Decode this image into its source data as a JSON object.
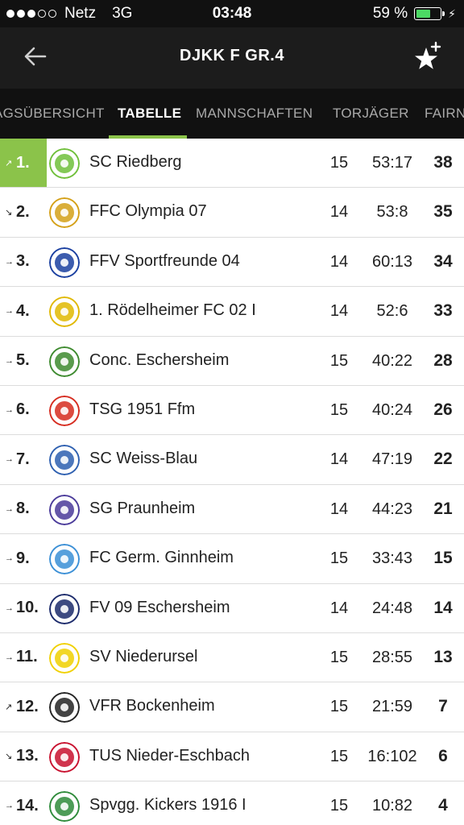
{
  "status_bar": {
    "carrier": "Netz",
    "network": "3G",
    "time": "03:48",
    "battery_percent": "59 %",
    "battery_level": 0.59
  },
  "navbar": {
    "title": "DJKK F GR.4",
    "back_icon": "back-arrow-icon",
    "favorite_icon": "star-plus-icon"
  },
  "tabs": [
    {
      "label": "AGSÜBERSICHT",
      "active": false
    },
    {
      "label": "TABELLE",
      "active": true
    },
    {
      "label": "MANNSCHAFTEN",
      "active": false
    },
    {
      "label": "TORJÄGER",
      "active": false
    },
    {
      "label": "FAIRN",
      "active": false
    }
  ],
  "colors": {
    "accent": "#8bc34a",
    "header_bg": "#1c1c1c",
    "statusbar_bg": "#111111"
  },
  "table": [
    {
      "trend": "↗",
      "rank": "1.",
      "team": "SC Riedberg",
      "games": "15",
      "goals": "53:17",
      "points": "38",
      "logo_color": "#6fbf3a"
    },
    {
      "trend": "↘",
      "rank": "2.",
      "team": "FFC Olympia 07",
      "games": "14",
      "goals": "53:8",
      "points": "35",
      "logo_color": "#d4a017"
    },
    {
      "trend": "→",
      "rank": "3.",
      "team": "FFV Sportfreunde 04",
      "games": "14",
      "goals": "60:13",
      "points": "34",
      "logo_color": "#1a3fa0"
    },
    {
      "trend": "→",
      "rank": "4.",
      "team": "1. Rödelheimer FC 02 I",
      "games": "14",
      "goals": "52:6",
      "points": "33",
      "logo_color": "#e0b800"
    },
    {
      "trend": "→",
      "rank": "5.",
      "team": "Conc. Eschersheim",
      "games": "15",
      "goals": "40:22",
      "points": "28",
      "logo_color": "#3d8a2e"
    },
    {
      "trend": "→",
      "rank": "6.",
      "team": "TSG 1951 Ffm",
      "games": "15",
      "goals": "40:24",
      "points": "26",
      "logo_color": "#d62b1f"
    },
    {
      "trend": "→",
      "rank": "7.",
      "team": "SC Weiss-Blau",
      "games": "14",
      "goals": "47:19",
      "points": "22",
      "logo_color": "#2d5fb0"
    },
    {
      "trend": "→",
      "rank": "8.",
      "team": "SG Praunheim",
      "games": "14",
      "goals": "44:23",
      "points": "21",
      "logo_color": "#4a3a9a"
    },
    {
      "trend": "→",
      "rank": "9.",
      "team": "FC Germ. Ginnheim",
      "games": "15",
      "goals": "33:43",
      "points": "15",
      "logo_color": "#3a8fd6"
    },
    {
      "trend": "→",
      "rank": "10.",
      "team": "FV 09 Eschersheim",
      "games": "14",
      "goals": "24:48",
      "points": "14",
      "logo_color": "#1b2a6b"
    },
    {
      "trend": "→",
      "rank": "11.",
      "team": "SV Niederursel",
      "games": "15",
      "goals": "28:55",
      "points": "13",
      "logo_color": "#f0d000"
    },
    {
      "trend": "↗",
      "rank": "12.",
      "team": "VFR Bockenheim",
      "games": "15",
      "goals": "21:59",
      "points": "7",
      "logo_color": "#222222"
    },
    {
      "trend": "↘",
      "rank": "13.",
      "team": "TUS Nieder-Eschbach",
      "games": "15",
      "goals": "16:102",
      "points": "6",
      "logo_color": "#c8102e"
    },
    {
      "trend": "→",
      "rank": "14.",
      "team": "Spvgg. Kickers 1916 I",
      "games": "15",
      "goals": "10:82",
      "points": "4",
      "logo_color": "#2e8b3a"
    }
  ]
}
